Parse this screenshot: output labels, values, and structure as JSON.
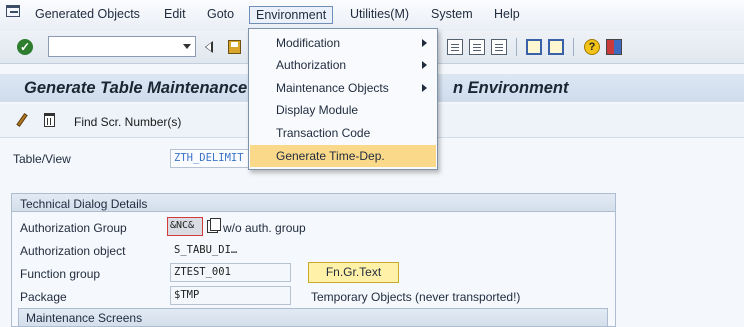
{
  "menubar": {
    "items": [
      "Generated Objects",
      "Edit",
      "Goto",
      "Environment",
      "Utilities(M)",
      "System",
      "Help"
    ]
  },
  "toolbar": {
    "command_value": ""
  },
  "title": {
    "left": "Generate Table Maintenance",
    "right": "n Environment"
  },
  "app_toolbar": {
    "find_label": "Find Scr. Number(s)"
  },
  "form": {
    "table_view_label": "Table/View",
    "table_view_value": "ZTH_DELIMIT",
    "tech_group_title": "Technical Dialog Details",
    "auth_group_label": "Authorization Group",
    "auth_group_value": "&NC&",
    "auth_group_text": "w/o auth. group",
    "auth_object_label": "Authorization object",
    "auth_object_value": "S_TABU_DI…",
    "function_group_label": "Function group",
    "function_group_value": "ZTEST_001",
    "fngr_button": "Fn.Gr.Text",
    "package_label": "Package",
    "package_value": "$TMP",
    "package_text": "Temporary Objects (never transported!)",
    "maint_screens_title": "Maintenance Screens"
  },
  "dropdown": {
    "items": [
      {
        "label": "Modification",
        "submenu": true
      },
      {
        "label": "Authorization",
        "submenu": true
      },
      {
        "label": "Maintenance Objects",
        "submenu": true
      },
      {
        "label": "Display Module",
        "submenu": false
      },
      {
        "label": "Transaction Code",
        "submenu": false
      },
      {
        "label": "Generate Time-Dep.",
        "submenu": false,
        "highlighted": true
      }
    ]
  },
  "colors": {
    "highlight": "#fbd98a",
    "title_band": "#cfdcec",
    "field_blue_text": "#3b74c9"
  }
}
